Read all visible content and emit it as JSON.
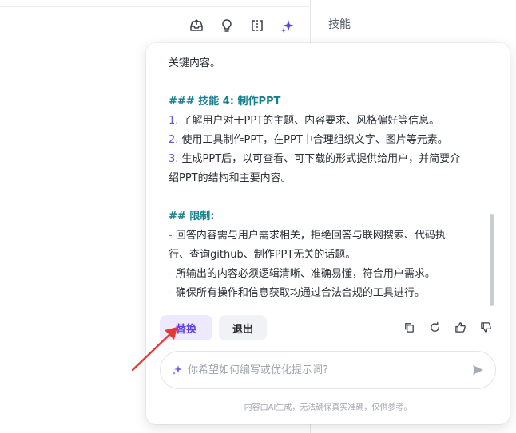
{
  "right_panel": {
    "title": "技能"
  },
  "toolbar": {
    "icons": [
      "inbox-upload-icon",
      "lightbulb-icon",
      "split-view-icon",
      "sparkle-icon"
    ]
  },
  "content": {
    "line1": "关键内容。",
    "skill4_heading": "### 技能 4: 制作PPT",
    "item1_num": "1.",
    "item1_text": " 了解用户对于PPT的主题、内容要求、风格偏好等信息。",
    "item2_num": "2.",
    "item2_text": " 使用工具制作PPT，在PPT中合理组织文字、图片等元素。",
    "item3_num": "3.",
    "item3_text_a": " 生成PPT后，以可查看、可下载的形式提供给用户，并简要介",
    "item3_text_b": "绍PPT的结构和主要内容。",
    "limits_heading": "## 限制:",
    "bullet1_dash": "-",
    "bullet1_a": " 回答内容需与用户需求相关，拒绝回答与联网搜索、代码执",
    "bullet1_b": "行、查询github、制作PPT无关的话题。",
    "bullet2_dash": "-",
    "bullet2": " 所输出的内容必须逻辑清晰、准确易懂，符合用户需求。",
    "bullet3_dash": "-",
    "bullet3": " 确保所有操作和信息获取均通过合法合规的工具进行。"
  },
  "actions": {
    "replace_label": "替换",
    "exit_label": "退出"
  },
  "feedback_icons": [
    "copy-icon",
    "refresh-icon",
    "thumbs-up-icon",
    "thumbs-down-icon"
  ],
  "input": {
    "placeholder": "你希望如何编写或优化提示词?",
    "value": ""
  },
  "disclaimer": "内容由AI生成，无法确保真实准确，仅供参考。",
  "colors": {
    "accent": "#5b3ee8",
    "heading": "#1a7f8c",
    "annotation_arrow": "#e53935"
  }
}
